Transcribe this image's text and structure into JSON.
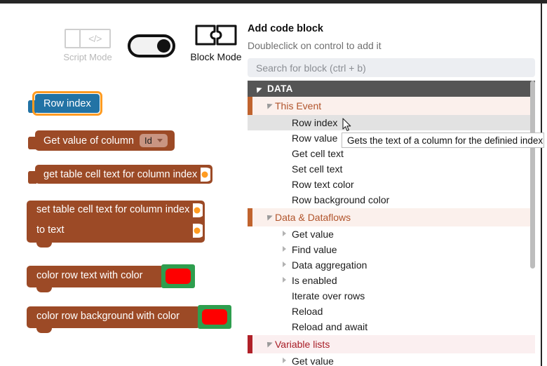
{
  "mode_bar": {
    "script_mode_label": "Script Mode",
    "script_icon_glyph": "</>",
    "block_mode_label": "Block Mode",
    "toggle_state": "on"
  },
  "canvas": {
    "blocks": [
      {
        "id": "row-index",
        "text": "Row index",
        "kind": "value",
        "color": "#2273a5",
        "selected": true,
        "selection_color": "#ff9b21"
      },
      {
        "id": "get-value-of-column",
        "text": "Get value of column",
        "kind": "value",
        "color": "#9c4a26",
        "dropdown_value": "Id"
      },
      {
        "id": "get-table-cell-text",
        "text": "get table cell text for column index",
        "kind": "value-with-socket",
        "color": "#9c4a26"
      },
      {
        "id": "set-table-cell-text",
        "text_line1": "set table cell text for column index",
        "text_line2": "to text",
        "kind": "statement-2row",
        "color": "#9c4a26"
      },
      {
        "id": "color-row-text",
        "text": "color row text with color",
        "kind": "statement-with-color",
        "color": "#9c4a26",
        "slot_color": "#2e9e4e",
        "swatch_color": "#fe0000"
      },
      {
        "id": "color-row-background",
        "text": "color row background with color",
        "kind": "statement-with-color",
        "color": "#9c4a26",
        "slot_color": "#2e9e4e",
        "swatch_color": "#fe0000"
      }
    ]
  },
  "panel": {
    "title": "Add code block",
    "subtitle": "Doubleclick on control to add it",
    "search_placeholder": "Search for block (ctrl + b)",
    "search_value": "",
    "root_group": "DATA",
    "groups": [
      {
        "label": "This Event",
        "accent": "#c0632e",
        "text_color": "#b1542b",
        "items": [
          {
            "label": "Row index",
            "selected": true,
            "expandable": false
          },
          {
            "label": "Row value",
            "selected": false,
            "expandable": false
          },
          {
            "label": "Get cell text",
            "selected": false,
            "expandable": false
          },
          {
            "label": "Set cell text",
            "selected": false,
            "expandable": false
          },
          {
            "label": "Row text color",
            "selected": false,
            "expandable": false
          },
          {
            "label": "Row background color",
            "selected": false,
            "expandable": false
          }
        ]
      },
      {
        "label": "Data & Dataflows",
        "accent": "#c0632e",
        "text_color": "#b1542b",
        "items": [
          {
            "label": "Get value",
            "selected": false,
            "expandable": true
          },
          {
            "label": "Find value",
            "selected": false,
            "expandable": true
          },
          {
            "label": "Data aggregation",
            "selected": false,
            "expandable": true
          },
          {
            "label": "Is enabled",
            "selected": false,
            "expandable": true
          },
          {
            "label": "Iterate over rows",
            "selected": false,
            "expandable": false
          },
          {
            "label": "Reload",
            "selected": false,
            "expandable": false
          },
          {
            "label": "Reload and await",
            "selected": false,
            "expandable": false
          }
        ]
      },
      {
        "label": "Variable lists",
        "accent": "#b02028",
        "text_color": "#a81d26",
        "items": [
          {
            "label": "Get value",
            "selected": false,
            "expandable": true
          }
        ]
      }
    ]
  },
  "tooltip": {
    "text": "Gets the text of a column for the definied index"
  }
}
